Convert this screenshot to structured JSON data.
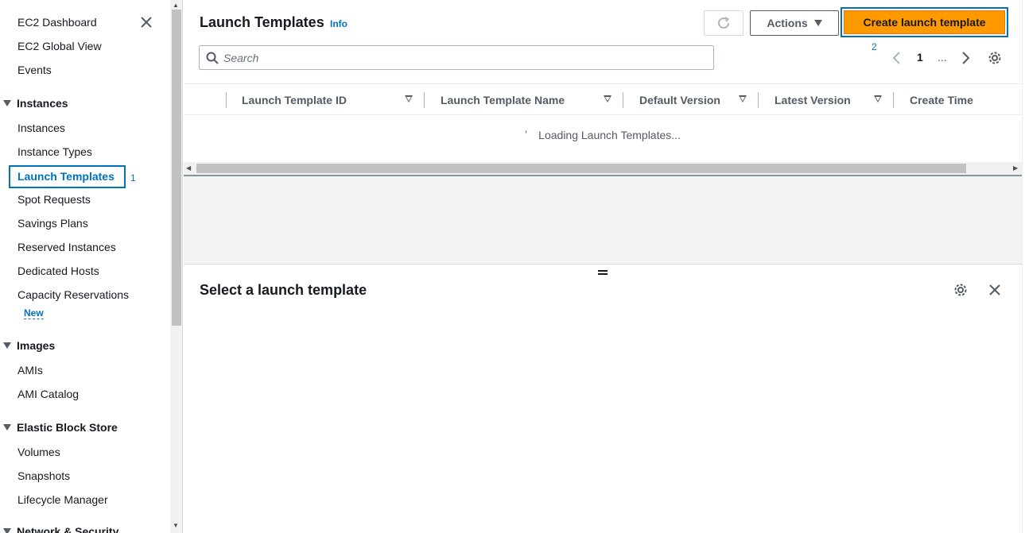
{
  "sidebar": {
    "top_items": [
      "EC2 Dashboard",
      "EC2 Global View",
      "Events"
    ],
    "instances_section": "Instances",
    "instances_items": [
      "Instances",
      "Instance Types",
      "Launch Templates",
      "Spot Requests",
      "Savings Plans",
      "Reserved Instances",
      "Dedicated Hosts",
      "Capacity Reservations"
    ],
    "new_badge": "New",
    "images_section": "Images",
    "images_items": [
      "AMIs",
      "AMI Catalog"
    ],
    "ebs_section": "Elastic Block Store",
    "ebs_items": [
      "Volumes",
      "Snapshots",
      "Lifecycle Manager"
    ],
    "network_section": "Network & Security",
    "marker_1": "1"
  },
  "header": {
    "title": "Launch Templates",
    "info": "Info",
    "actions_label": "Actions",
    "create_label": "Create launch template",
    "marker_2": "2"
  },
  "search": {
    "placeholder": "Search"
  },
  "pagination": {
    "current_page": "1",
    "ellipsis": "..."
  },
  "table": {
    "columns": [
      "Launch Template ID",
      "Launch Template Name",
      "Default Version",
      "Latest Version",
      "Create Time"
    ],
    "loading_text": "Loading Launch Templates..."
  },
  "split_panel": {
    "title": "Select a launch template"
  },
  "colors": {
    "accent": "#0073bb",
    "primary_button": "#ff9900"
  }
}
